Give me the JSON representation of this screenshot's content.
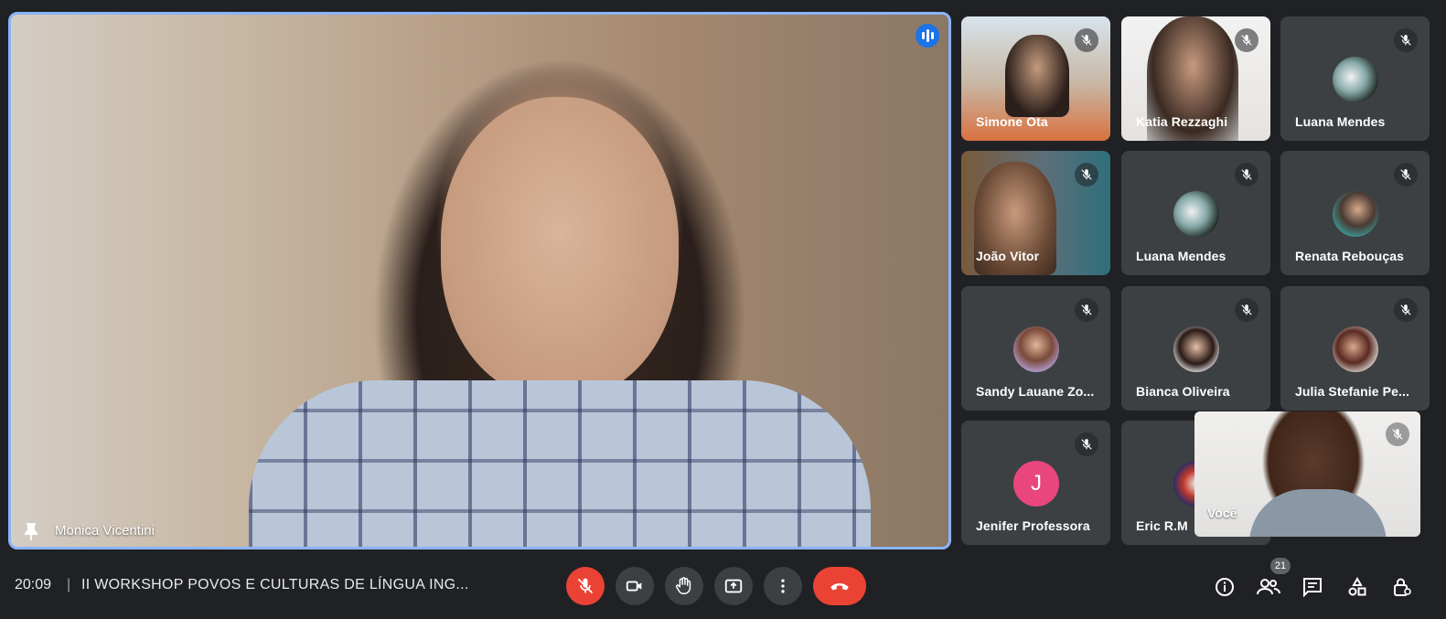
{
  "main_speaker": {
    "name": "Monica Vicentini"
  },
  "participants": [
    {
      "name": "Simone Ota",
      "type": "video"
    },
    {
      "name": "Katia Rezzaghi",
      "type": "video"
    },
    {
      "name": "Luana Mendes",
      "type": "avatar"
    },
    {
      "name": "João Vitor",
      "type": "video"
    },
    {
      "name": "Luana Mendes",
      "type": "avatar"
    },
    {
      "name": "Renata Rebouças",
      "type": "avatar"
    },
    {
      "name": "Sandy Lauane Zo...",
      "type": "avatar"
    },
    {
      "name": "Bianca Oliveira",
      "type": "avatar"
    },
    {
      "name": "Julia Stefanie Pe...",
      "type": "avatar"
    },
    {
      "name": "Jenifer Professora",
      "type": "letter",
      "letter": "J"
    },
    {
      "name": "Eric R.M",
      "type": "avatar"
    }
  ],
  "self_view": {
    "name": "Você"
  },
  "bottom_bar": {
    "time": "20:09",
    "separator": "|",
    "meeting_title": "II WORKSHOP POVOS E CULTURAS DE LÍNGUA ING...",
    "participant_count": "21"
  },
  "icons": {
    "mic": "mic-off-icon",
    "camera": "videocam-icon",
    "hand": "raise-hand-icon",
    "present": "present-screen-icon",
    "more": "more-vert-icon",
    "leave": "call-end-icon",
    "info": "info-icon",
    "people": "people-icon",
    "chat": "chat-icon",
    "activities": "activities-icon",
    "host": "host-controls-icon"
  },
  "colors": {
    "accent": "#8ab4f8",
    "danger": "#ea4335",
    "surface": "#3c4043",
    "background": "#202124"
  }
}
